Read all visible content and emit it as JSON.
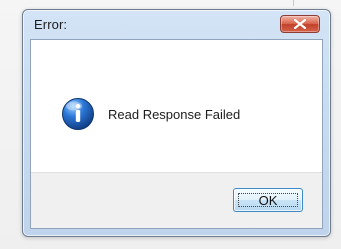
{
  "dialog": {
    "title": "Error:",
    "message": "Read Response Failed",
    "ok_label": "OK",
    "icon": "information-icon",
    "close_icon": "close-icon"
  },
  "colors": {
    "title_frame": "#c7dbf1",
    "close_button": "#d4634a",
    "info_icon": "#1f5fae",
    "ok_border": "#3f89c7"
  }
}
